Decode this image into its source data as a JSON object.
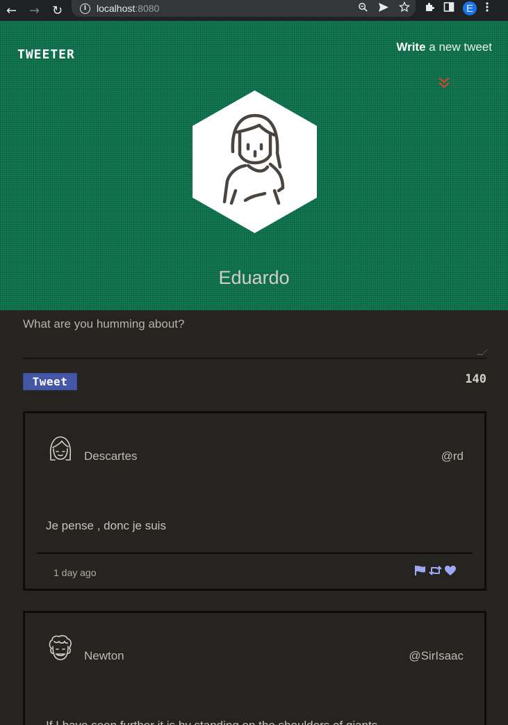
{
  "browser": {
    "url_host": "localhost",
    "url_port": ":8080",
    "profile_initial": "E"
  },
  "header": {
    "brand": "Tweeter",
    "write_bold": "Write",
    "write_rest": " a new tweet",
    "profile_name": "Eduardo"
  },
  "compose": {
    "placeholder": "What are you humming about?",
    "button_label": "Tweet",
    "char_count": "140"
  },
  "tweets": [
    {
      "name": "Descartes",
      "handle": "@rd",
      "text": "Je pense , donc je suis",
      "time": "1 day ago"
    },
    {
      "name": "Newton",
      "handle": "@SirIsaac",
      "text": "If I have seen further it is by standing on the shoulders of giants"
    }
  ],
  "colors": {
    "header_green": "#127a54",
    "page_bg": "#262421",
    "button_blue": "#4456a6",
    "action_icons": "#9fa8f5",
    "chevron_red": "#d9442b"
  }
}
